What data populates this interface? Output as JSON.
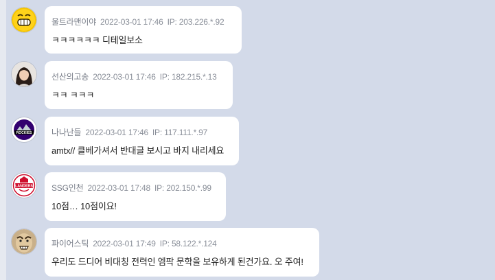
{
  "messages": [
    {
      "nickname": "울트라맨이야",
      "date": "2022-03-01 17:46",
      "ip": "IP: 203.226.*.92",
      "text": "ㅋㅋㅋㅋㅋㅋ 디테일보소",
      "avatar": "yellow-grin-face-icon"
    },
    {
      "nickname": "선산의고송",
      "date": "2022-03-01 17:46",
      "ip": "IP: 182.215.*.13",
      "text": "ㅋㅋ ㅋㅋㅋ",
      "avatar": "woman-portrait-photo"
    },
    {
      "nickname": "나나난들",
      "date": "2022-03-01 17:46",
      "ip": "IP: 117.111.*.97",
      "text": "amtx// 클베가셔서 반대글 보시고 바지 내리세요",
      "avatar": "rockies-logo-icon"
    },
    {
      "nickname": "SSG인천",
      "date": "2022-03-01 17:48",
      "ip": "IP: 202.150.*.99",
      "text": "10점… 10점이요!",
      "avatar": "landers-logo-icon"
    },
    {
      "nickname": "파이어스틱",
      "date": "2022-03-01 17:49",
      "ip": "IP: 58.122.*.124",
      "text": "우리도 드디어 비대칭 전력인 엠팍 문학을 보유하게 된건가요. 오 주여!",
      "avatar": "cartoon-face-icon"
    }
  ],
  "colors": {
    "background": "#d3dae9",
    "bubble": "#ffffff",
    "meta": "#8a8f99",
    "text": "#222222"
  }
}
